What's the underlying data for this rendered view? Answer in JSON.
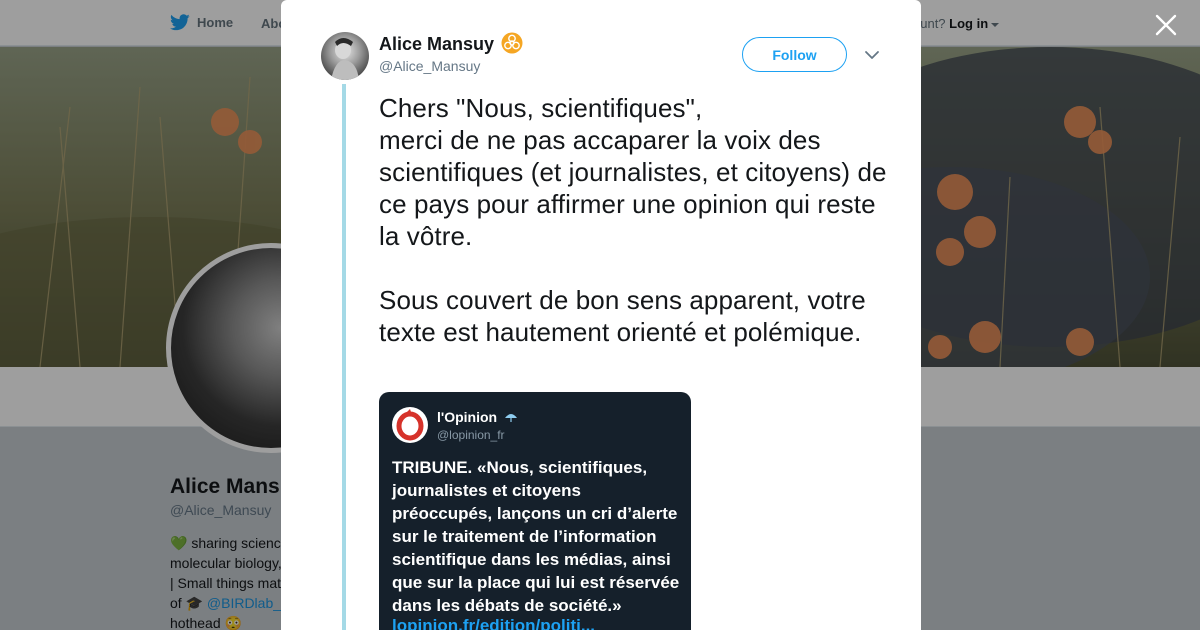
{
  "topnav": {
    "home_label": "Home",
    "about_label": "Abo",
    "account_prompt": "ccount?",
    "login_label": "Log in"
  },
  "profile": {
    "name": "Alice Mans",
    "handle": "@Alice_Mansuy",
    "bio_lines": [
      "💚 sharing scienc",
      "molecular biology,",
      "| Small things mat",
      "of 🎓 ",
      "hothead 😳"
    ],
    "bio_link": "@BIRDlab_I"
  },
  "modal": {
    "author": {
      "name": "Alice Mansuy",
      "handle": "@Alice_Mansuy",
      "badge_icon": "biohazard-icon"
    },
    "follow_label": "Follow",
    "tweet_text": "Chers \"Nous, scientifiques\",\nmerci de ne pas accaparer la voix des scientifiques (et journalistes, et citoyens) de ce pays pour affirmer une opinion qui reste la vôtre.\n\nSous couvert de bon sens apparent, votre texte est hautement orienté et polémique.",
    "embed": {
      "name": "l'Opinion",
      "handle": "@lopinion_fr",
      "text": "TRIBUNE. «Nous, scientifiques, journalistes et citoyens préoccupés, lançons un cri d’alerte sur le traitement de l’information scientifique dans les médias, ainsi que sur la place qui lui est réservée dans les débats de société.»",
      "link": "lopinion.fr/edition/politi..."
    }
  },
  "colors": {
    "accent": "#1da1f2",
    "thread_line": "#a4d9e6",
    "embed_bg": "#15202b",
    "badge": "#f5a623",
    "opinion_red": "#d6322a"
  }
}
